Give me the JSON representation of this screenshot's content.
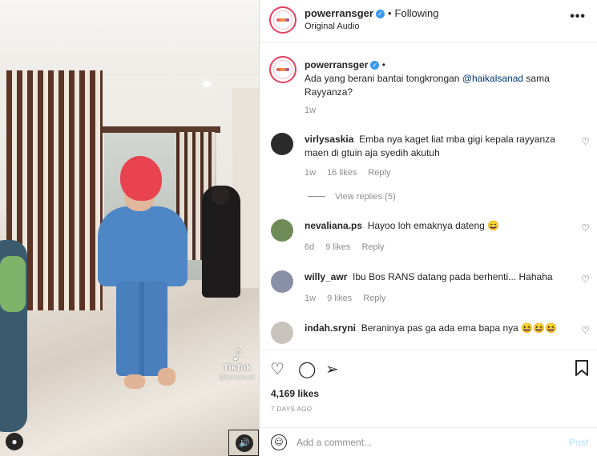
{
  "video": {
    "watermark_brand": "TikTok",
    "watermark_handle": "@bersanad7"
  },
  "header": {
    "username": "powerransger",
    "separator": "•",
    "follow_status": "Following",
    "audio": "Original Audio",
    "more_icon": "more-horizontal-icon"
  },
  "caption": {
    "username": "powerransger",
    "separator": "•",
    "text_before": "Ada yang berani bantai tongkrongan ",
    "mention": "@haikalsanad",
    "text_after": " sama Rayyanza?",
    "age": "1w"
  },
  "comments": [
    {
      "username": "virlysaskia",
      "text": "Emba nya kaget liat mba gigi kepala rayyanza maen di gtuin aja syedih akutuh",
      "age": "1w",
      "likes": "16 likes",
      "reply": "Reply",
      "avatar_color": "#2b2b2b"
    },
    {
      "username": "nevaliana.ps",
      "text": "Hayoo loh emaknya dateng 😄",
      "age": "6d",
      "likes": "9 likes",
      "reply": "Reply",
      "avatar_color": "#6f8c58"
    },
    {
      "username": "willy_awr",
      "text": "Ibu Bos RANS datang pada berhenti... Hahaha",
      "age": "1w",
      "likes": "9 likes",
      "reply": "Reply",
      "avatar_color": "#8a8fa8"
    },
    {
      "username": "indah.sryni",
      "text": "Beraninya pas ga ada ema bapa nya 😆😆😆",
      "age": "",
      "likes": "",
      "reply": "",
      "avatar_color": "#c9c3bd"
    }
  ],
  "view_replies": "View replies (5)",
  "likes_count": "4,169 likes",
  "posted_ago": "7 DAYS AGO",
  "comment_input": {
    "placeholder": "Add a comment...",
    "value": ""
  },
  "post_label": "Post",
  "colors": {
    "link": "#00376b",
    "verified": "#3897f0",
    "post_disabled": "#b2dffc",
    "meta": "#8e8e8e"
  },
  "icons": {
    "like": "heart-icon",
    "comment": "comment-icon",
    "share": "paper-plane-icon",
    "save": "bookmark-icon",
    "emoji": "emoji-icon",
    "sound": "speaker-icon",
    "account": "user-icon"
  }
}
